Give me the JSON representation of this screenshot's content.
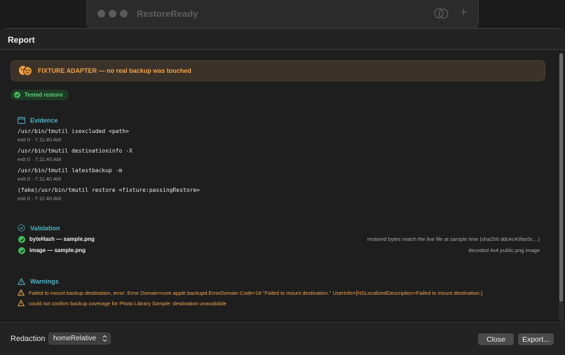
{
  "background_window": {
    "title": "RestoreReady"
  },
  "sheet": {
    "title": "Report"
  },
  "banner": {
    "icon": "theater-masks-icon",
    "text": "FIXTURE ADAPTER — no real backup was touched"
  },
  "status_pill": {
    "label": "Tested restore",
    "color": "#3fbf5a"
  },
  "evidence": {
    "heading": "Evidence",
    "items": [
      {
        "command": "/usr/bin/tmutil isexcluded <path>",
        "meta": "exit 0 · 7:11:40 AM"
      },
      {
        "command": "/usr/bin/tmutil destinationinfo -X",
        "meta": "exit 0 · 7:11:40 AM"
      },
      {
        "command": "/usr/bin/tmutil latestbackup -m",
        "meta": "exit 0 · 7:11:40 AM"
      },
      {
        "command": "(fake)/usr/bin/tmutil restore <fixture:passingRestore>",
        "meta": "exit 0 · 7:11:40 AM"
      }
    ]
  },
  "validation": {
    "heading": "Validation",
    "items": [
      {
        "name": "byteHash — sample.png",
        "note": "restored bytes match the live file at sample time (sha256 ddc4c43fac0c…)"
      },
      {
        "name": "image — sample.png",
        "note": "decoded 4x4 public.png image"
      }
    ]
  },
  "warnings": {
    "heading": "Warnings",
    "items": [
      {
        "text": "Failed to mount backup destination, error: Error Domain=com.apple.backupd.ErrorDomain Code=18 \"Failed to mount destination.\" UserInfo={NSLocalizedDescription=Failed to mount destination.}"
      },
      {
        "text": "could not confirm backup coverage for Photo Library Sample: destination unavailable"
      }
    ]
  },
  "footer": {
    "redaction_label": "Redaction",
    "redaction_value": "homeRelative",
    "close_label": "Close",
    "export_label": "Export..."
  },
  "colors": {
    "accent_teal": "#4fb3c4",
    "warning_orange": "#f0a348",
    "success_green": "#3fbf5a"
  }
}
